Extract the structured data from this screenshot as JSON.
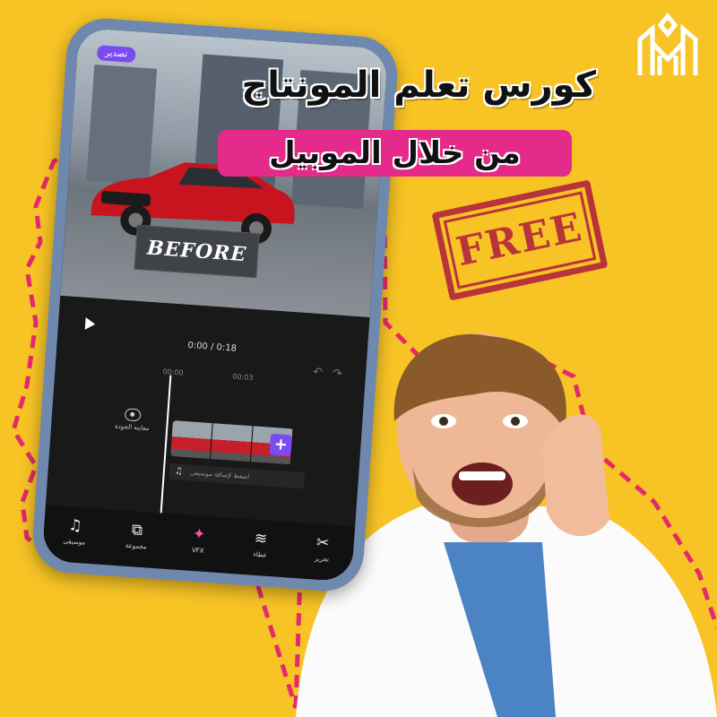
{
  "headline": {
    "line1": "كورس تعلم المونتاج",
    "line2": "من خلال الموبيل"
  },
  "stamp": {
    "text": "FREE"
  },
  "phone": {
    "export_label": "تصدير",
    "before_label": "BEFORE",
    "timecode": "0:00 / 0:18",
    "ruler": [
      "00:00",
      "00:03"
    ],
    "quality_label": "معاينة الجودة",
    "music_hint": "اضغط لإضافة موسيقى",
    "add_clip": "+",
    "toolbar": [
      {
        "icon": "music-note-icon",
        "glyph": "♫",
        "label": "موسيقى"
      },
      {
        "icon": "overlay-icon",
        "glyph": "⧉",
        "label": "مجموعة"
      },
      {
        "icon": "vfx-icon",
        "glyph": "✦",
        "label": "VFX"
      },
      {
        "icon": "layers-icon",
        "glyph": "≋",
        "label": "غطاء"
      },
      {
        "icon": "scissors-icon",
        "glyph": "✂",
        "label": "تحرير"
      }
    ]
  },
  "colors": {
    "background": "#f7c325",
    "accent_pink": "#e42a8a",
    "app_purple": "#7a4cf0",
    "stamp_red": "#b8343a"
  }
}
